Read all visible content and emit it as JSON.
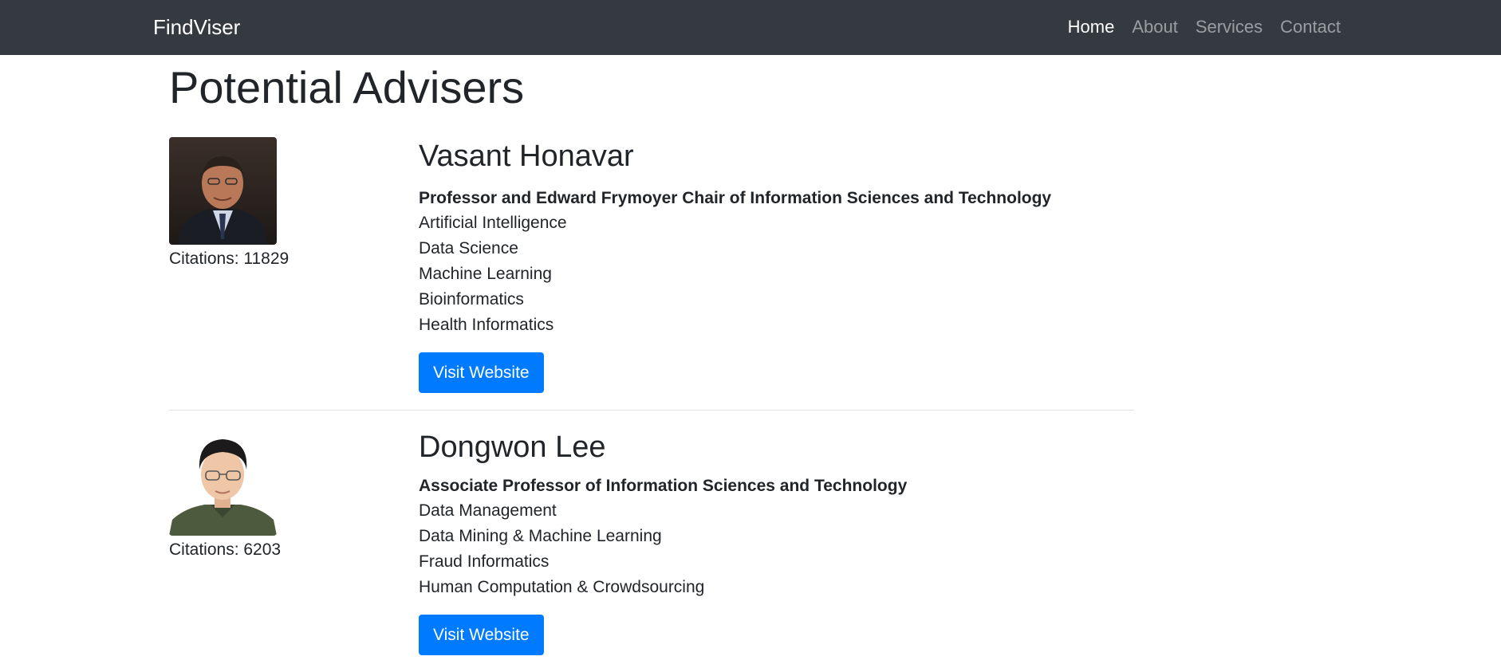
{
  "navbar": {
    "brand": "FindViser",
    "links": [
      "Home",
      "About",
      "Services",
      "Contact"
    ]
  },
  "page": {
    "title": "Potential Advisers"
  },
  "advisers": [
    {
      "name": "Vasant Honavar",
      "role": "Professor and Edward Frymoyer Chair of Information Sciences and Technology",
      "citations": "Citations: 11829",
      "interests": [
        "Artificial Intelligence",
        "Data Science",
        "Machine Learning",
        "Bioinformatics",
        "Health Informatics"
      ],
      "button_label": "Visit Website"
    },
    {
      "name": "Dongwon Lee",
      "role": "Associate Professor of Information Sciences and Technology",
      "citations": "Citations: 6203",
      "interests": [
        "Data Management",
        "Data Mining & Machine Learning",
        "Fraud Informatics",
        "Human Computation & Crowdsourcing"
      ],
      "button_label": "Visit Website"
    }
  ],
  "colors": {
    "navbar_bg": "#343a40",
    "button_bg": "#007bff",
    "text": "#212529"
  }
}
